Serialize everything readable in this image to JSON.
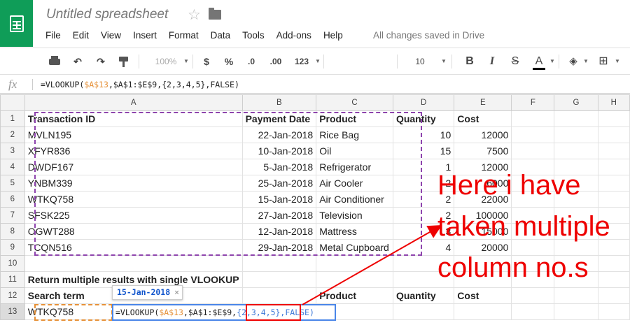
{
  "app": {
    "doc_title": "Untitled spreadsheet",
    "save_status": "All changes saved in Drive"
  },
  "menu": [
    "File",
    "Edit",
    "View",
    "Insert",
    "Format",
    "Data",
    "Tools",
    "Add-ons",
    "Help"
  ],
  "toolbar": {
    "zoom": "100%",
    "currency": "$",
    "percent": "%",
    "decrease_decimal": ".0",
    "increase_decimal": ".00",
    "number_format": "123",
    "font_size": "10",
    "bold": "B",
    "italic": "I",
    "strike": "S",
    "text_color": "A"
  },
  "formula_bar": {
    "fx": "fx",
    "formula_prefix": "=VLOOKUP(",
    "ref1": "$A$13",
    "comma1": ",",
    "ref2": "$A$1:$E$9",
    "rest": ",{2,3,4,5},FALSE)"
  },
  "columns": [
    "A",
    "B",
    "C",
    "D",
    "E",
    "F",
    "G",
    "H"
  ],
  "rows": [
    {
      "n": "1",
      "cells": [
        "Transaction ID",
        "Payment Date",
        "Product",
        "Quantity",
        "Cost"
      ]
    },
    {
      "n": "2",
      "cells": [
        "MVLN195",
        "22-Jan-2018",
        "Rice Bag",
        "10",
        "12000"
      ]
    },
    {
      "n": "3",
      "cells": [
        "XFYR836",
        "10-Jan-2018",
        "Oil",
        "15",
        "7500"
      ]
    },
    {
      "n": "4",
      "cells": [
        "DWDF167",
        "5-Jan-2018",
        "Refrigerator",
        "1",
        "12000"
      ]
    },
    {
      "n": "5",
      "cells": [
        "YNBM339",
        "25-Jan-2018",
        "Air Cooler",
        "2",
        "6000"
      ]
    },
    {
      "n": "6",
      "cells": [
        "WTKQ758",
        "15-Jan-2018",
        "Air Conditioner",
        "2",
        "22000"
      ]
    },
    {
      "n": "7",
      "cells": [
        "SFSK225",
        "27-Jan-2018",
        "Television",
        "2",
        "100000"
      ]
    },
    {
      "n": "8",
      "cells": [
        "OGWT288",
        "12-Jan-2018",
        "Mattress",
        "3",
        "15000"
      ]
    },
    {
      "n": "9",
      "cells": [
        "TCQN516",
        "29-Jan-2018",
        "Metal Cupboard",
        "4",
        "20000"
      ]
    },
    {
      "n": "10",
      "cells": [
        "",
        "",
        "",
        "",
        ""
      ]
    },
    {
      "n": "11",
      "cells": [
        "Return multiple results with single VLOOKUP",
        "",
        "",
        "",
        ""
      ]
    },
    {
      "n": "12",
      "cells": [
        "Search term",
        "",
        "Product",
        "Quantity",
        "Cost"
      ]
    },
    {
      "n": "13",
      "cells": [
        "WTKQ758",
        "",
        "",
        "",
        ""
      ]
    }
  ],
  "active_cell": {
    "prefix": "=VLOOKUP(",
    "ref1": "$A$13",
    "ref2": ",$A$1:$E$9,",
    "array": "{2,3,4,5}",
    "tail": ",FALSE)"
  },
  "tooltip": {
    "value": "15-Jan-2018",
    "close": "×"
  },
  "annotation": {
    "line1": "Here i have",
    "line2": "taken multiple",
    "line3": "column no.s",
    "color": "#ee0000"
  },
  "colors": {
    "brand_green": "#0f9d58",
    "copy_range": "#8e44ad",
    "ref_orange": "#e69138",
    "ref_blue": "#3c78d8",
    "selection_blue": "#4a86e8"
  }
}
